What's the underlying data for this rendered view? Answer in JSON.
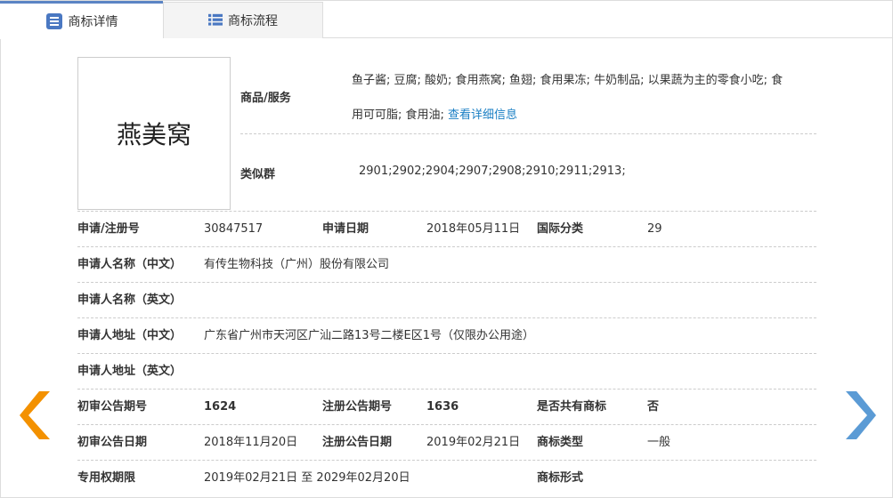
{
  "tabs": [
    {
      "label": "商标详情",
      "icon": "list-detail-icon"
    },
    {
      "label": "商标流程",
      "icon": "list-icon"
    }
  ],
  "trademark_name": "燕美窝",
  "goods": {
    "label": "商品/服务",
    "line1": "鱼子酱; 豆腐; 酸奶; 食用燕窝; 鱼翅; 食用果冻; 牛奶制品; 以果蔬为主的零食小吃; 食",
    "line2": "用可可脂; 食用油;",
    "link": "查看详细信息"
  },
  "similar": {
    "label": "类似群",
    "value": "2901;2902;2904;2907;2908;2910;2911;2913;"
  },
  "rows": [
    {
      "l1": "申请/注册号",
      "v1": "30847517",
      "l2": "申请日期",
      "v2": "2018年05月11日",
      "l3": "国际分类",
      "v3": "29"
    },
    {
      "l1": "申请人名称（中文）",
      "v1": "有传生物科技（广州）股份有限公司"
    },
    {
      "l1": "申请人名称（英文）",
      "v1": ""
    },
    {
      "l1": "申请人地址（中文）",
      "v1": "广东省广州市天河区广汕二路13号二楼E区1号（仅限办公用途）"
    },
    {
      "l1": "申请人地址（英文）",
      "v1": ""
    },
    {
      "l1": "初审公告期号",
      "v1": "1624",
      "l2": "注册公告期号",
      "v2": "1636",
      "l3": "是否共有商标",
      "v3": "否"
    },
    {
      "l1": "初审公告日期",
      "v1": "2018年11月20日",
      "l2": "注册公告日期",
      "v2": "2019年02月21日",
      "l3": "商标类型",
      "v3": "一般"
    },
    {
      "l1": "专用权期限",
      "v1": "2019年02月21日 至 2029年02月20日",
      "l3": "商标形式",
      "v3": ""
    }
  ],
  "colors": {
    "accent": "#5b84c4",
    "prev": "#f39100",
    "next": "#5b9bd5",
    "link": "#1a7fc4"
  }
}
